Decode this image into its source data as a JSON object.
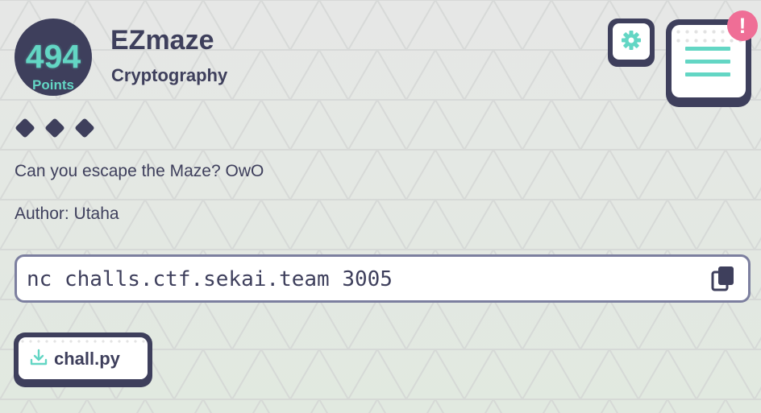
{
  "challenge": {
    "points_value": "494",
    "points_label": "Points",
    "title": "EZmaze",
    "category": "Cryptography",
    "difficulty": 3,
    "description": "Can you escape the Maze? OwO",
    "author": "Author: Utaha",
    "connection": "nc challs.ctf.sekai.team 3005"
  },
  "files": [
    {
      "label": "chall.py",
      "icon": "download-icon"
    }
  ],
  "header": {
    "settings_icon": "gear-icon",
    "menu_icon": "menu-icon",
    "notification_mark": "!"
  },
  "colors": {
    "dark": "#3e3f5c",
    "accent": "#63d6c4",
    "notification": "#ef6e96"
  }
}
